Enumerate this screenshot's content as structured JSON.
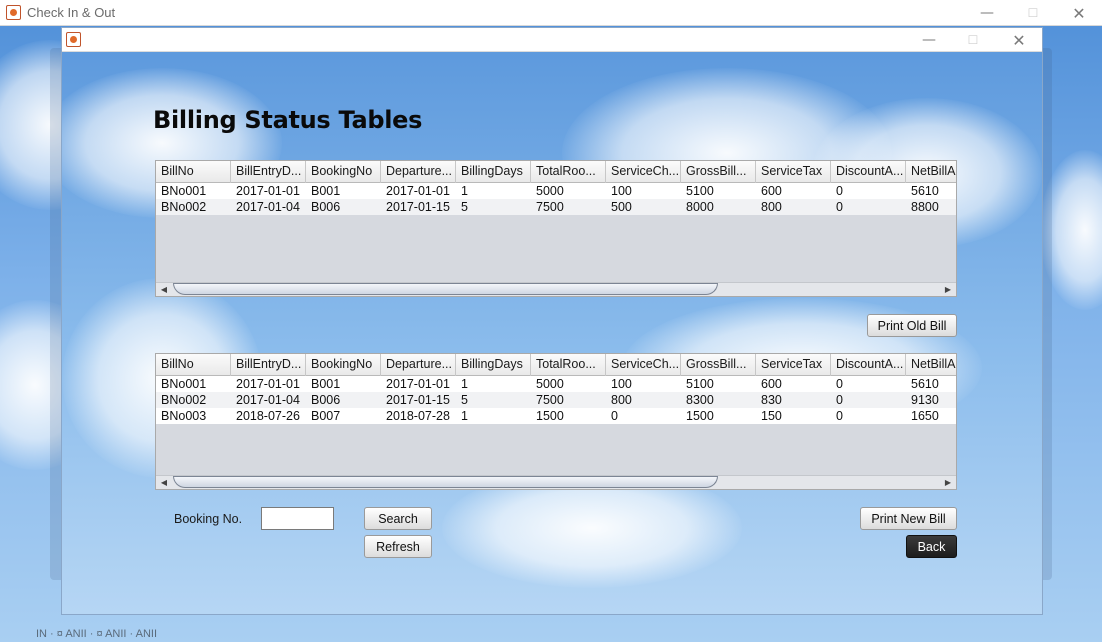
{
  "outer_window": {
    "title": "Check In & Out"
  },
  "page": {
    "title": "Billing Status Tables"
  },
  "columns": [
    "BillNo",
    "BillEntryD...",
    "BookingNo",
    "Departure...",
    "BillingDays",
    "TotalRoo...",
    "ServiceCh...",
    "GrossBill...",
    "ServiceTax",
    "DiscountA...",
    "NetBillAm"
  ],
  "old_bills_table": {
    "rows": [
      [
        "BNo001",
        "2017-01-01",
        "B001",
        "2017-01-01",
        "1",
        "5000",
        "100",
        "5100",
        "600",
        "0",
        "5610"
      ],
      [
        "BNo002",
        "2017-01-04",
        "B006",
        "2017-01-15",
        "5",
        "7500",
        "500",
        "8000",
        "800",
        "0",
        "8800"
      ]
    ]
  },
  "new_bills_table": {
    "rows": [
      [
        "BNo001",
        "2017-01-01",
        "B001",
        "2017-01-01",
        "1",
        "5000",
        "100",
        "5100",
        "600",
        "0",
        "5610"
      ],
      [
        "BNo002",
        "2017-01-04",
        "B006",
        "2017-01-15",
        "5",
        "7500",
        "800",
        "8300",
        "830",
        "0",
        "9130"
      ],
      [
        "BNo003",
        "2018-07-26",
        "B007",
        "2018-07-28",
        "1",
        "1500",
        "0",
        "1500",
        "150",
        "0",
        "1650"
      ]
    ]
  },
  "buttons": {
    "print_old_bill": "Print Old Bill",
    "print_new_bill": "Print New Bill",
    "search": "Search",
    "refresh": "Refresh",
    "back": "Back"
  },
  "search": {
    "booking_label": "Booking No.",
    "booking_value": ""
  },
  "scroll_left_glyph": "◀",
  "scroll_right_glyph": "▶",
  "window_controls": {
    "minimize": "—",
    "maximize": "☐",
    "close": "✕"
  },
  "colors": {
    "back_button": "#1d1d1d",
    "sky": "#6fa8e6"
  },
  "background_fragment": "IN · ¤ ANII · ¤ ANII · ANII"
}
